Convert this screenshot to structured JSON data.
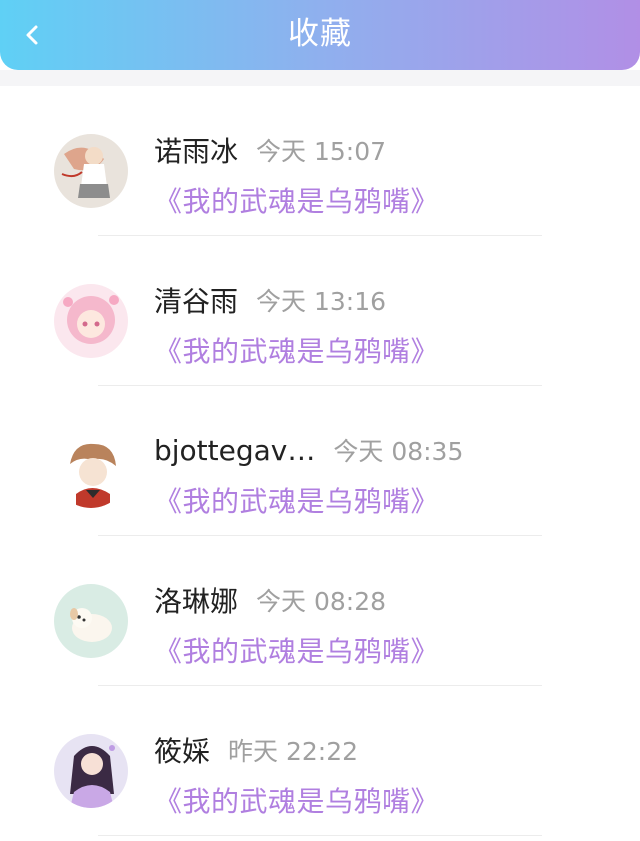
{
  "header": {
    "title": "收藏",
    "back_icon": "chevron-left-icon",
    "gradient": [
      "#5fd0f5",
      "#b18fe6"
    ]
  },
  "colors": {
    "book_title": "#b07fe0",
    "time": "#a0a0a0",
    "name": "#222222"
  },
  "items": [
    {
      "name": "诺雨冰",
      "time": "今天 15:07",
      "book": "《我的武魂是乌鸦嘴》",
      "avatar": "anime-girl-ribbon-avatar"
    },
    {
      "name": "清谷雨",
      "time": "今天 13:16",
      "book": "《我的武魂是乌鸦嘴》",
      "avatar": "pink-anime-girl-avatar"
    },
    {
      "name": "bjottegav…",
      "time": "今天 08:35",
      "book": "《我的武魂是乌鸦嘴》",
      "avatar": "anime-boy-avatar"
    },
    {
      "name": "洛琳娜",
      "time": "今天 08:28",
      "book": "《我的武魂是乌鸦嘴》",
      "avatar": "puppy-avatar"
    },
    {
      "name": "筱婇",
      "time": "昨天 22:22",
      "book": "《我的武魂是乌鸦嘴》",
      "avatar": "fantasy-girl-avatar"
    }
  ]
}
